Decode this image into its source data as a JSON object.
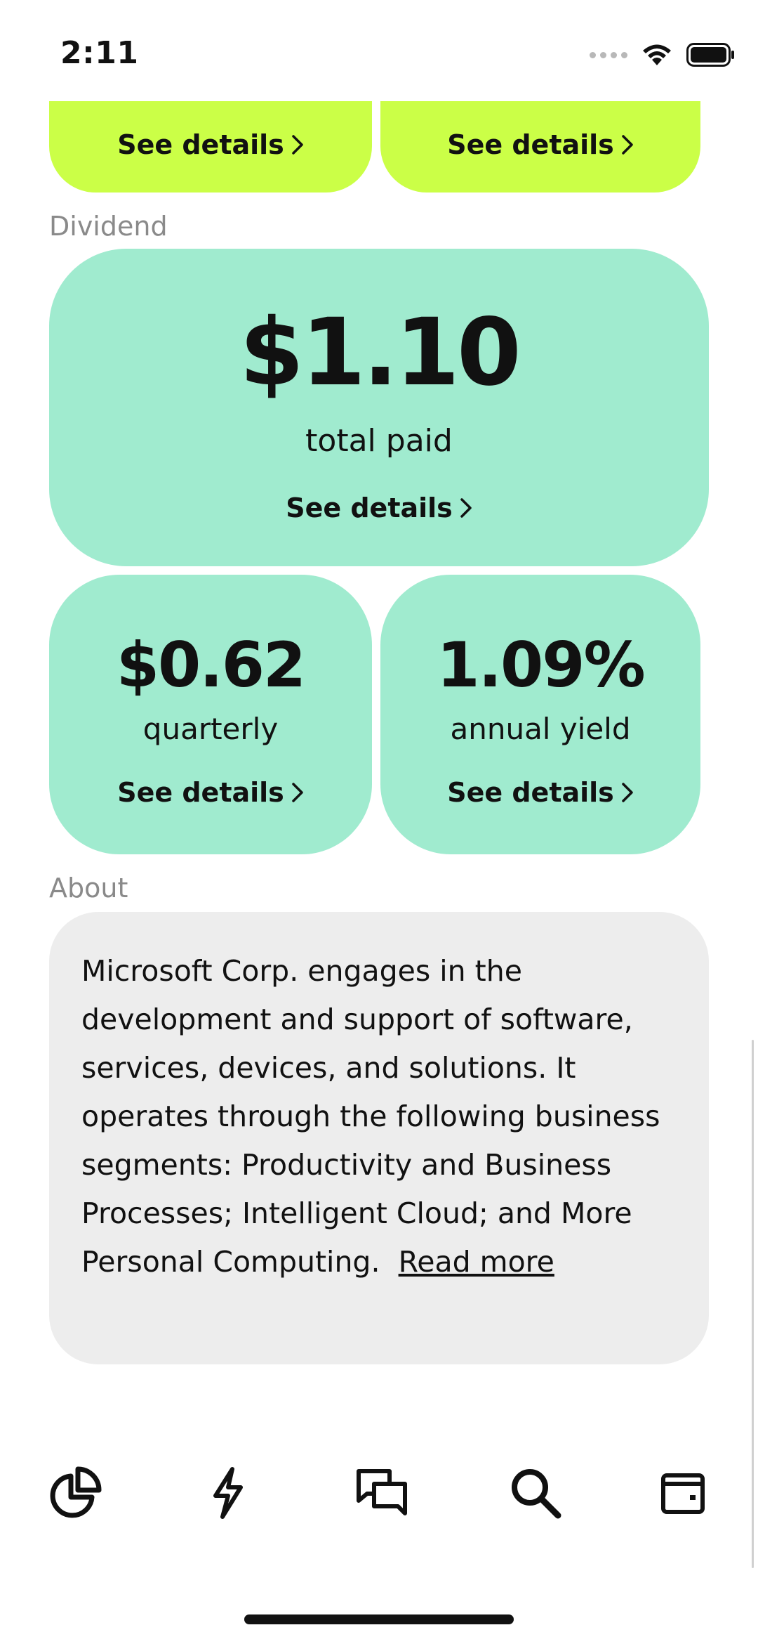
{
  "status_bar": {
    "time": "2:11"
  },
  "top_cards": [
    {
      "label": "See details"
    },
    {
      "label": "See details"
    }
  ],
  "dividend": {
    "section_label": "Dividend",
    "total": {
      "value": "$1.10",
      "caption": "total paid",
      "link": "See details"
    },
    "quarterly": {
      "value": "$0.62",
      "caption": "quarterly",
      "link": "See details"
    },
    "yield": {
      "value": "1.09%",
      "caption": "annual yield",
      "link": "See details"
    }
  },
  "about": {
    "section_label": "About",
    "text": "Microsoft Corp. engages in the development and support of software, services, devices, and solutions. It operates through the following business segments: Productivity and Business Processes; Intelligent Cloud; and More Personal Computing.",
    "read_more": "Read more"
  },
  "colors": {
    "lime_card": "#cbff47",
    "mint_card": "#a0ebcf",
    "about_card": "#ededed",
    "section_label": "#8a8a8a"
  },
  "bottom_nav": [
    {
      "icon": "portfolio-pie-icon"
    },
    {
      "icon": "lightning-icon"
    },
    {
      "icon": "chat-bubbles-icon"
    },
    {
      "icon": "search-icon"
    },
    {
      "icon": "wallet-icon"
    }
  ]
}
